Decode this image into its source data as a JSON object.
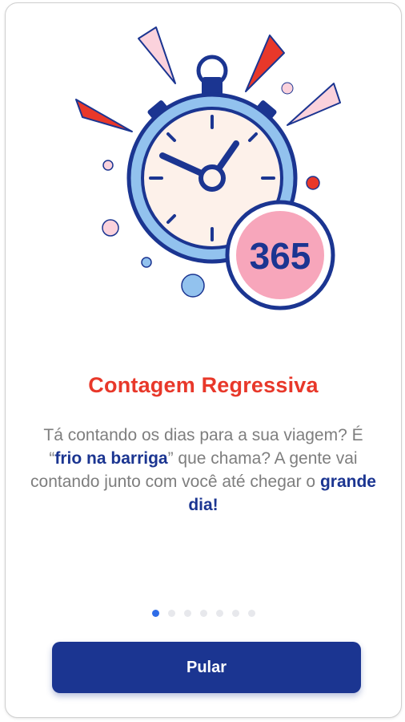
{
  "onboarding": {
    "badge_number": "365",
    "title": "Contagem Regressiva",
    "description": {
      "part1": "Tá contando os dias para a sua viagem? É “",
      "highlight1": "frio na barriga",
      "part2": "” que chama? A gente vai contando junto com você até chegar o ",
      "highlight2": "grande dia!"
    },
    "pagination": {
      "total": 7,
      "current": 1
    },
    "skip_label": "Pular"
  },
  "colors": {
    "title": "#e8382a",
    "primary": "#1b3591",
    "active_dot": "#2f6de8",
    "clock_face": "#fdf1ea",
    "clock_ring": "#92c2ee",
    "badge_fill": "#f7a6bb",
    "accent_pink": "#f9b3c4",
    "accent_red": "#e8382a"
  },
  "icons": {
    "illustration": "stopwatch-icon",
    "badge": "countdown-badge-icon"
  }
}
